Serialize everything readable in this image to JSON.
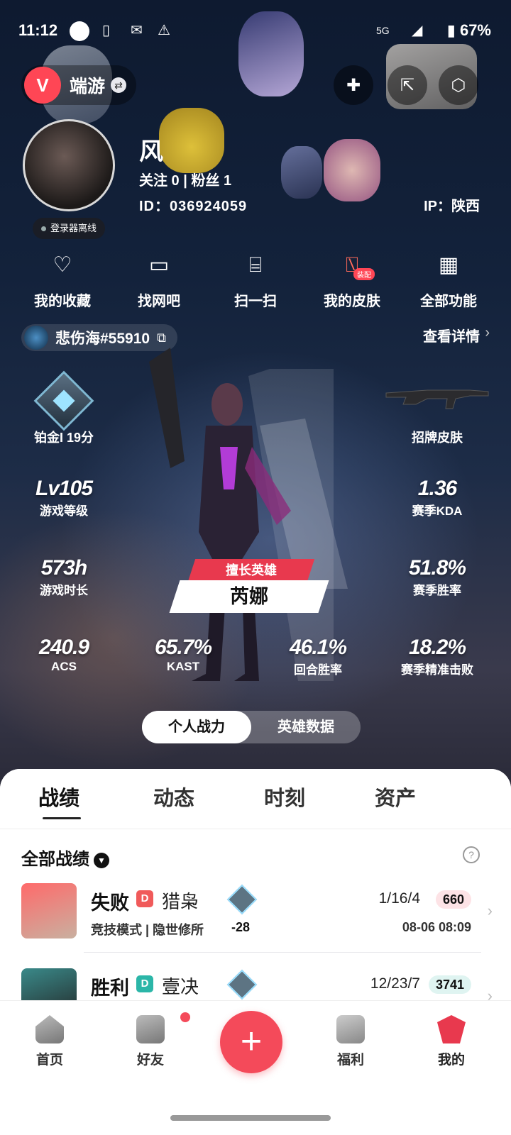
{
  "status_bar": {
    "time": "11:12",
    "network": "5G",
    "battery": "67%"
  },
  "header": {
    "brand_logo": "V",
    "brand_name": "端游",
    "icons": [
      "valorant-logo-icon",
      "switch-icon",
      "add-card-icon",
      "share-icon",
      "settings-icon"
    ]
  },
  "profile": {
    "nickname": "风",
    "follow_text": "关注 0  |  粉丝 1",
    "id_text": "ID：036924059",
    "ip_text": "IP：陕西",
    "login_status": "登录器离线"
  },
  "actions": [
    {
      "label": "我的收藏",
      "icon": "♡"
    },
    {
      "label": "找网吧",
      "icon": "▭"
    },
    {
      "label": "扫一扫",
      "icon": "⌸"
    },
    {
      "label": "我的皮肤",
      "icon": "⍂",
      "tag": "装配"
    },
    {
      "label": "全部功能",
      "icon": "▦"
    }
  ],
  "riot": {
    "riot_id": "悲伤海#55910",
    "detail_label": "查看详情"
  },
  "rank": {
    "label": "铂金I 19分",
    "skin_label": "招牌皮肤"
  },
  "stats": {
    "level": {
      "value": "Lv105",
      "label": "游戏等级"
    },
    "kda": {
      "value": "1.36",
      "label": "赛季KDA"
    },
    "hours": {
      "value": "573h",
      "label": "游戏时长"
    },
    "winrate": {
      "value": "51.8%",
      "label": "赛季胜率"
    },
    "acs": {
      "value": "240.9",
      "label": "ACS"
    },
    "kast": {
      "value": "65.7%",
      "label": "KAST"
    },
    "round_win": {
      "value": "46.1%",
      "label": "回合胜率"
    },
    "precision": {
      "value": "18.2%",
      "label": "赛季精准击败"
    }
  },
  "hero": {
    "tag": "擅长英雄",
    "name": "芮娜"
  },
  "segment": {
    "active": "个人战力",
    "inactive": "英雄数据"
  },
  "tabs": [
    "战绩",
    "动态",
    "时刻",
    "资产"
  ],
  "list": {
    "filter_label": "全部战绩",
    "help_icon": "?",
    "matches": [
      {
        "result": "失败",
        "result_color": "#e8394e",
        "dtag": "D",
        "dtag_color": "#f05a5a",
        "map": "猎枭",
        "mode": "竞技模式 | 隐世修所",
        "delta": "-28",
        "kda": "1/16/4",
        "score": "660",
        "score_bg": "#fde3e6",
        "datetime": "08-06 08:09"
      },
      {
        "result": "胜利",
        "result_color": "#2bb6a8",
        "dtag": "D",
        "dtag_color": "#2bb6a8",
        "map": "壹决",
        "kda": "12/23/7",
        "score": "3741",
        "score_bg": "#dff4f1"
      }
    ]
  },
  "bottom_nav": [
    {
      "label": "首页"
    },
    {
      "label": "好友"
    },
    {
      "label": "+"
    },
    {
      "label": "福利"
    },
    {
      "label": "我的"
    }
  ]
}
